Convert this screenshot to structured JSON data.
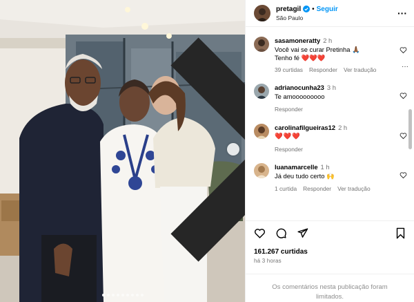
{
  "post": {
    "username": "pretagil",
    "separator": "•",
    "follow_label": "Seguir",
    "location": "São Paulo",
    "more_label": "···"
  },
  "comments": [
    {
      "username": "sasamoneratty",
      "time": "2 h",
      "text": "Você vai se curar Pretinha 🙏🏾",
      "text2": "Tenho fé ❤️❤️❤️",
      "likes": "39 curtidas",
      "reply": "Responder",
      "translate": "Ver tradução",
      "more": "···"
    },
    {
      "username": "adrianocunha23",
      "time": "3 h",
      "text": "Te amooooooooo",
      "reply": "Responder"
    },
    {
      "username": "carolinafilgueiras12",
      "time": "2 h",
      "text": "❤️❤️❤️",
      "reply": "Responder"
    },
    {
      "username": "luanamarcelle",
      "time": "1 h",
      "text": "Já deu tudo certo 🙌",
      "likes": "1 curtida",
      "reply": "Responder",
      "translate": "Ver tradução"
    }
  ],
  "engagement": {
    "likes": "161.267 curtidas",
    "time": "há 3 horas",
    "limited_note": "Os comentários nesta publicação foram limitados."
  },
  "carousel": {
    "slide_count": 9,
    "active_slide": 1
  },
  "colors": {
    "follow": "#0095f6",
    "verified": "#0095f6",
    "heart": "#ed4956",
    "muted": "#737373"
  },
  "icons": [
    "verified-badge-icon",
    "heart-icon",
    "comment-icon",
    "share-icon",
    "bookmark-icon",
    "chevron-right-icon",
    "more-icon"
  ]
}
